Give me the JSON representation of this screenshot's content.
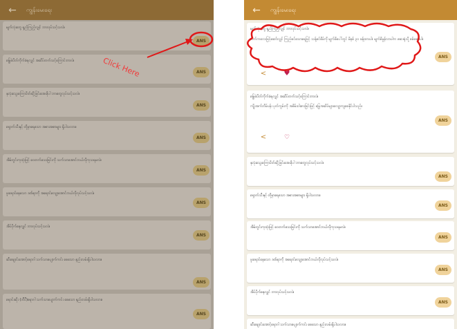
{
  "left_screen": {
    "appbar": {
      "back_icon": "←",
      "title": "ကျွန်းမေးရေး"
    },
    "questions": [
      {
        "text": "မျက်လုံးတွေ ရှည်ကြည့်လျှင် ဘာလုပ်သင့်သလဲ။",
        "ans_label": "ANS"
      },
      {
        "text": "မြွေခဲပိတ်ကိုက်ခံရလျှင် အဆိပ်တက်သင့်ကြောင်ဘာလဲ။",
        "ans_label": "ANS"
      },
      {
        "text": "နှလုံးသွေးကြောပိတ်ဆို့ခြင်းအေးဖိုပါ ဘာတွေလုပ်သင့်သလဲ။",
        "ans_label": "ANS"
      },
      {
        "text": "ရှောက်သီးနှင့် တို့မှာရေသော အစားအစာများ ရှိပါသလား။",
        "ans_label": "ANS"
      },
      {
        "text": "အိမ်တွင်းကုထုံးဖြင့် ဝေတက်သေးခြင်းကို သက်သာအောင်ဘယ်လိုကုသရမလဲ။",
        "ans_label": "ANS"
      },
      {
        "text": "ဖူးရောင်နေသော ဒဏ်ရာကို အရောင်လျော့အောင်ဘယ်လိုလုပ်သင့်သလဲ။",
        "ans_label": "ANS"
      },
      {
        "text": "အိပ်ပိုက်နေလျှင် ဘာလုပ်သင့်သလဲ။",
        "ans_label": "ANS"
      },
      {
        "text": "ဆီးချောင်းအောင့်ရောဂါ သက်သာပျောက်ကင်း စေသော နည်းလမ်းရှိပါသလား။",
        "ans_label": "ANS"
      },
      {
        "text": "ရောင်းဆိုး (ဘီပီ)ရောဂါ သက်သာပျောက်ကင်း စေသော နည်းလမ်းရှိပါသလား။",
        "ans_label": "ANS"
      }
    ]
  },
  "annotation": {
    "click_here": "Click Here",
    "color": "#f03a3a"
  },
  "right_screen": {
    "appbar": {
      "back_icon": "←",
      "title": "ကျွန်းမေးရေး"
    },
    "expanded": [
      {
        "question": "မျက်လုံးတွေ ရှည်ကြည့်လျှင် ဘာလုပ်သင့်သလဲ။",
        "answer": "လက်ကလေးဖြင့်ဆော်လျှင် ကြည်စင်သောရေဖြင့် သန့်စင်စိမ်ကို မျက်စိပေါ်တွင် မိနစ် ၃၀ ခန့်ထားပါ။ မျက်စိမှုန်လာပါက ဆေးရုံသို့ စစ်ဆေးပါ။",
        "ans_label": "ANS"
      },
      {
        "question": "မြွေခဲပိတ်ကိုက်ခံရလျှင် အဆိပ်တက်သင့်ကြောင်ဘာလဲ။",
        "answer": "ကျိုးအက်တိမ်ပန်း ပုတ်ကွမ်းကို အစိမ်းဝါးစားခြင်းဖြင့် မြွေအဆိပ်များလျော့ကျစေနိုင်ပါသည်။",
        "ans_label": "ANS"
      }
    ],
    "questions": [
      {
        "text": "နှလုံးသွေးကြောပိတ်ဆို့ခြင်းအေးဖိုပါ ဘာတွေလုပ်သင့်သလဲ။",
        "ans_label": "ANS"
      },
      {
        "text": "ရှောက်သီးနှင့် တို့မှာရေသော အစားအစာများ ရှိပါသလား။",
        "ans_label": "ANS"
      },
      {
        "text": "အိမ်တွင်းကုထုံးဖြင့် ဝေတက်သေးခြင်းကို သက်သာအောင်ဘယ်လိုကုသရမလဲ။",
        "ans_label": "ANS"
      },
      {
        "text": "ဖူးရောင်နေသော ဒဏ်ရာကို အရောင်လျော့အောင်ဘယ်လိုလုပ်သင့်သလဲ။",
        "ans_label": "ANS"
      },
      {
        "text": "အိပ်ပိုက်နေလျှင် ဘာလုပ်သင့်သလဲ။",
        "ans_label": "ANS"
      },
      {
        "text": "ဆီးချောင်းအောင့်ရောဂါ သက်သာပျောက်ကင်း စေသော နည်းလမ်းရှိပါသလား။",
        "ans_label": "ANS"
      }
    ]
  },
  "colors": {
    "accent": "#c38a33",
    "heart_filled": "#c0204f",
    "ans_bg": "#f0d39b"
  },
  "icons": {
    "back": "back-arrow-icon",
    "share": "share-icon",
    "favorite": "heart-icon"
  }
}
